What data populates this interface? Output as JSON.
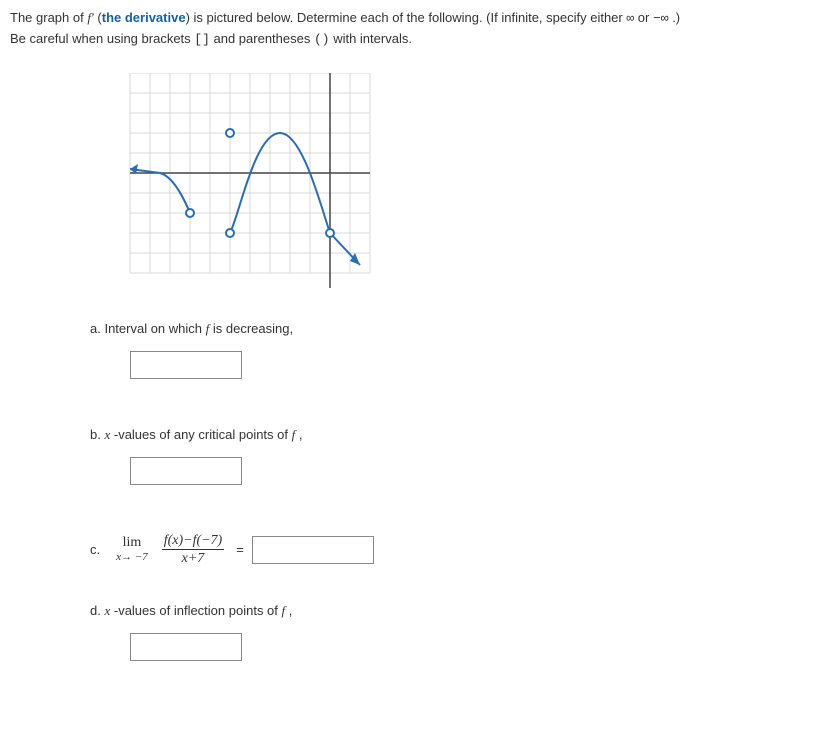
{
  "intro": {
    "text1_a": "The graph of ",
    "fprime": "f′",
    "text1_b": " (",
    "deriv_bold": "the derivative",
    "text1_c": ") is pictured below. Determine each of the following. (If infinite, specify either ",
    "inf": "∞",
    "or": " or ",
    "ninf": "−∞",
    "text1_d": " .)",
    "text2_a": "Be careful when using brackets ",
    "brackets": "[]",
    "text2_b": " and parentheses ",
    "parens": "()",
    "text2_c": " with intervals."
  },
  "parts": {
    "a": {
      "label_pre": "a. Interval on which ",
      "f": "f",
      "label_post": " is decreasing,"
    },
    "b": {
      "label_pre": "b. ",
      "x": "x",
      "label_mid": " -values of any critical points of ",
      "f": "f",
      "label_post": " ,"
    },
    "c": {
      "label": "c.",
      "lim_top": "lim",
      "lim_sub": "x→ −7",
      "frac_num": "f(x)−f(−7)",
      "frac_den": "x+7",
      "equals": "="
    },
    "d": {
      "label_pre": "d. ",
      "x": "x",
      "label_mid": " -values of inflection points of ",
      "f": "f",
      "label_post": " ,"
    }
  },
  "chart_data": {
    "type": "line",
    "title": "",
    "xlabel": "",
    "ylabel": "",
    "xlim": [
      -10,
      2
    ],
    "ylim": [
      -4,
      5
    ],
    "grid": true,
    "axes_origin": [
      0,
      0
    ],
    "curve_points": [
      {
        "x": -10,
        "y": 0.2,
        "arrow": "start"
      },
      {
        "x": -8.5,
        "y": 0
      },
      {
        "x": -7,
        "y": -2,
        "open": true,
        "endpoint": true
      },
      {
        "x": -5,
        "y": 2,
        "open": true,
        "endpoint": true
      },
      {
        "x": -5,
        "y": -3,
        "open": true,
        "endpoint": true
      },
      {
        "x": -4,
        "y": -1.4
      },
      {
        "x": -2.5,
        "y": 2
      },
      {
        "x": -1.3,
        "y": 0
      },
      {
        "x": 0,
        "y": -3,
        "open": true,
        "endpoint": true
      },
      {
        "x": 1.5,
        "y": -4.5,
        "arrow": "end"
      }
    ],
    "series": [
      {
        "name": "f′(x)",
        "values": "see curve_points"
      }
    ]
  }
}
